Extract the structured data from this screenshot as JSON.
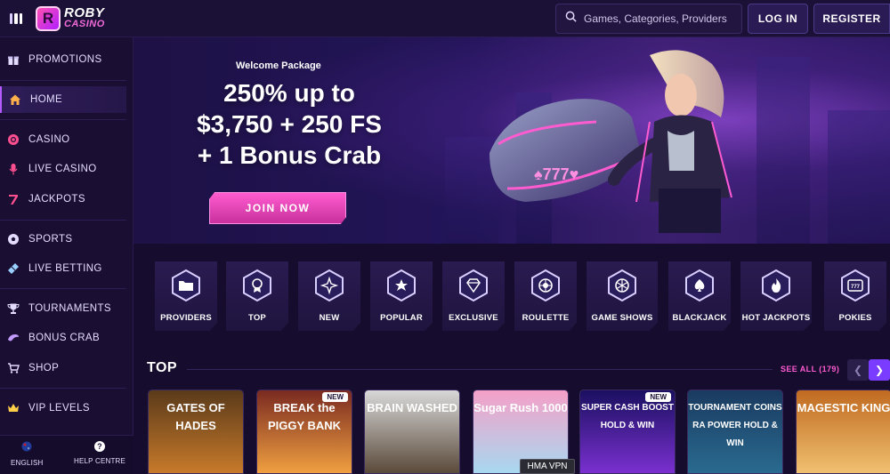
{
  "header": {
    "logo_line1": "ROBY",
    "logo_line2": "CASINO",
    "logo_letter": "R",
    "search_placeholder": "Games, Categories, Providers",
    "login_label": "LOG IN",
    "register_label": "REGISTER"
  },
  "sidebar": {
    "items": [
      {
        "label": "PROMOTIONS",
        "icon": "gift-icon"
      },
      {
        "label": "HOME",
        "icon": "home-icon",
        "active": true
      },
      {
        "label": "CASINO",
        "icon": "chip-icon"
      },
      {
        "label": "LIVE CASINO",
        "icon": "microphone-icon"
      },
      {
        "label": "JACKPOTS",
        "icon": "seven-icon"
      },
      {
        "label": "SPORTS",
        "icon": "soccer-ball-icon"
      },
      {
        "label": "LIVE BETTING",
        "icon": "ticket-icon"
      },
      {
        "label": "TOURNAMENTS",
        "icon": "trophy-icon"
      },
      {
        "label": "BONUS CRAB",
        "icon": "crab-icon"
      },
      {
        "label": "SHOP",
        "icon": "cart-icon"
      },
      {
        "label": "VIP LEVELS",
        "icon": "crown-icon"
      }
    ],
    "footer": {
      "language_label": "ENGLISH",
      "help_label": "HELP CENTRE",
      "help_glyph": "?"
    }
  },
  "hero": {
    "welcome": "Welcome Package",
    "title_line1": "250% up to",
    "title_line2": "$3,750 + 250 FS",
    "title_line3": "+ 1 Bonus Crab",
    "cta_label": "JOIN NOW"
  },
  "categories": [
    {
      "label": "PROVIDERS",
      "icon": "folder-icon"
    },
    {
      "label": "TOP",
      "icon": "medal-icon"
    },
    {
      "label": "NEW",
      "icon": "sparkle-icon"
    },
    {
      "label": "POPULAR",
      "icon": "star-icon"
    },
    {
      "label": "EXCLUSIVE",
      "icon": "diamond-icon"
    },
    {
      "label": "ROULETTE",
      "icon": "roulette-icon"
    },
    {
      "label": "GAME SHOWS",
      "icon": "wheel-icon"
    },
    {
      "label": "BLACKJACK",
      "icon": "spade-icon"
    },
    {
      "label": "HOT JACKPOTS",
      "icon": "flame-icon"
    },
    {
      "label": "POKIES",
      "icon": "slot-machine-icon"
    }
  ],
  "top_section": {
    "title": "TOP",
    "see_all": "SEE ALL (179)",
    "prev_glyph": "❮",
    "next_glyph": "❯"
  },
  "games": [
    {
      "title": "GATES OF HADES",
      "badge": "",
      "colors": [
        "#5a3a1a",
        "#c87a2a"
      ]
    },
    {
      "title": "BREAK the PIGGY BANK",
      "badge": "NEW",
      "colors": [
        "#7a2a20",
        "#f0a040"
      ]
    },
    {
      "title": "BRAIN WASHED",
      "badge": "",
      "colors": [
        "#d8d8d8",
        "#5a4a3a"
      ]
    },
    {
      "title": "Sugar Rush 1000",
      "badge": "",
      "colors": [
        "#f5a0c8",
        "#a8d8f0"
      ]
    },
    {
      "title": "SUPER CASH BOOST HOLD & WIN",
      "badge": "NEW",
      "colors": [
        "#1a1060",
        "#7a30d0"
      ]
    },
    {
      "title": "TOURNAMENT COINS RA POWER HOLD & WIN",
      "badge": "",
      "colors": [
        "#1a3a60",
        "#2a6a90"
      ]
    },
    {
      "title": "MAGESTIC KING",
      "badge": "",
      "colors": [
        "#c06a20",
        "#f0c070"
      ]
    }
  ],
  "tooltip": "HMA VPN",
  "colors": {
    "accent_pink": "#ff5bd0",
    "accent_purple": "#7a3cff",
    "background": "#160d2e"
  }
}
